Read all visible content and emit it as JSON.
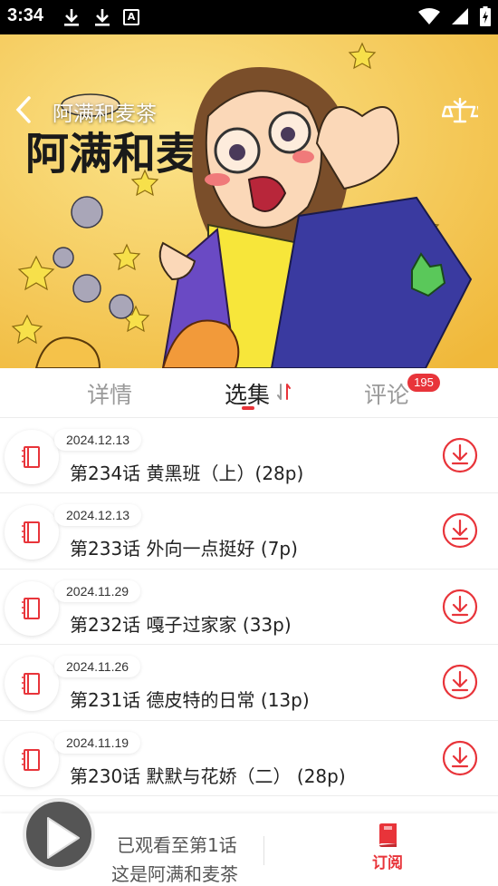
{
  "status_bar": {
    "time": "3:34",
    "left_icons": [
      "download-icon",
      "download-icon",
      "text-a-icon"
    ],
    "right_icons": [
      "wifi-icon",
      "cellular-icon",
      "battery-charging-icon"
    ]
  },
  "header": {
    "title": "阿满和麦茶",
    "back_icon": "back-arrow-icon",
    "action_icon": "balance-scale-icon",
    "cover_logo_text": "阿满和麦茶。"
  },
  "tabs": {
    "items": [
      {
        "label": "详情",
        "active": false
      },
      {
        "label": "选集",
        "active": true
      },
      {
        "label": "评论",
        "active": false
      }
    ],
    "comments_badge": "195",
    "accent_color": "#e8343a"
  },
  "episodes": [
    {
      "date": "2024.12.13",
      "title": "第234话 黄黑班（上）(28p)"
    },
    {
      "date": "2024.12.13",
      "title": "第233话 外向一点挺好 (7p)"
    },
    {
      "date": "2024.11.29",
      "title": "第232话 嘎子过家家 (33p)"
    },
    {
      "date": "2024.11.26",
      "title": "第231话 德皮特的日常 (13p)"
    },
    {
      "date": "2024.11.19",
      "title": "第230话 默默与花娇（二） (28p)"
    }
  ],
  "bottom_bar": {
    "progress_line1": "已观看至第1话",
    "progress_line2": "这是阿满和麦茶",
    "subscribe_label": "订阅"
  }
}
